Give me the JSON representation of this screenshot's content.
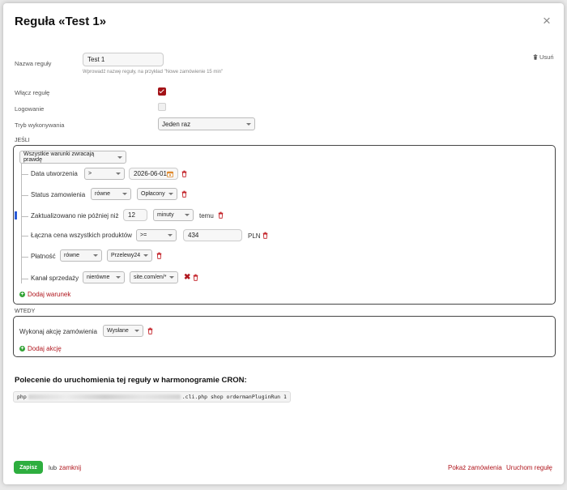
{
  "modal": {
    "title": "Reguła «Test 1»",
    "close_label": "×",
    "delete_label": "Usuń"
  },
  "form": {
    "name_label": "Nazwa reguły",
    "name_value": "Test 1",
    "name_hint": "Wprowadź nazwę reguły, na przykład \"Nowe zamówienie 15 min\"",
    "enable_label": "Włącz regułę",
    "enable_checked": true,
    "logging_label": "Logowanie",
    "logging_checked": false,
    "mode_label": "Tryb wykonywania",
    "mode_value": "Jeden raz"
  },
  "if_section": {
    "label": "JEŚLI",
    "match_select": "Wszystkie warunki zwracają prawdę",
    "conditions": [
      {
        "label": "Data utworzenia",
        "op": ">",
        "value": "2026-06-01"
      },
      {
        "label": "Status zamowienia",
        "op": "równe",
        "value": "Opłacony"
      },
      {
        "label": "Zaktualizowano nie później niż",
        "value": "12",
        "unit": "minuty",
        "suffix": "temu"
      },
      {
        "label": "Łączna cena wszystkich produktów",
        "op": ">=",
        "value": "434",
        "suffix": "PLN"
      },
      {
        "label": "Płatność",
        "op": "równe",
        "value": "Przelewy24"
      },
      {
        "label": "Kanał sprzedaży",
        "op": "nierówne",
        "value": "site.com/en/*"
      }
    ],
    "add_label": "Dodaj warunek"
  },
  "then_section": {
    "label": "WTEDY",
    "action_label": "Wykonaj akcję zamówienia",
    "action_value": "Wysłane",
    "add_label": "Dodaj akcję"
  },
  "cron": {
    "title": "Polecenie do uruchomienia tej reguły w harmonogramie CRON:",
    "cmd_prefix": "php",
    "cmd_suffix": ".cli.php shop ordermanPluginRun 1"
  },
  "footer": {
    "save_label": "Zapisz",
    "or_label": "lub",
    "close_label": "zamknij",
    "show_orders_label": "Pokaż zamówienia",
    "run_rule_label": "Uruchom regułę"
  },
  "colors": {
    "accent_red": "#b0171e",
    "save_green": "#2eae3f"
  }
}
